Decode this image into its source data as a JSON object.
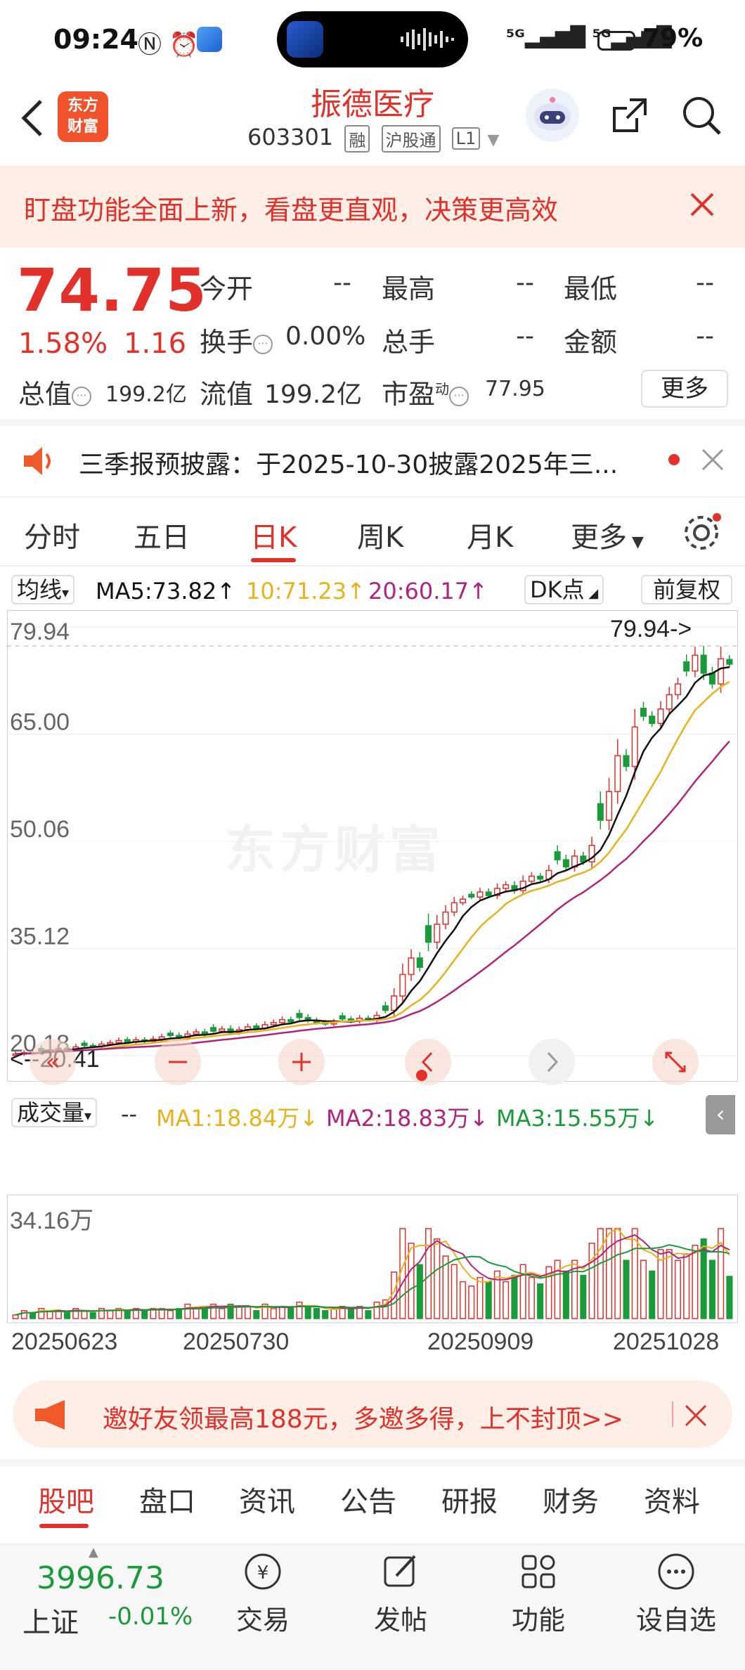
{
  "status": {
    "time": "09:24",
    "battery": "79%"
  },
  "header": {
    "logo_line1": "东方",
    "logo_line2": "财富",
    "stock_name": "振德医疗",
    "stock_code": "603301",
    "tag1": "融",
    "tag2": "沪股通",
    "tag3": "L1"
  },
  "banner": {
    "text": "盯盘功能全面上新，看盘更直观，决策更高效"
  },
  "quote": {
    "price": "74.75",
    "change_pct": "1.58%",
    "change": "1.16",
    "open_label": "今开",
    "open_value": "--",
    "high_label": "最高",
    "high_value": "--",
    "low_label": "最低",
    "low_value": "--",
    "turnover_label": "换手",
    "turnover_value": "0.00%",
    "volume_label": "总手",
    "volume_value": "--",
    "amount_label": "金额",
    "amount_value": "--",
    "mcap_label": "总值",
    "mcap_value": "199.2亿",
    "float_label": "流值",
    "float_value": "199.2亿",
    "pe_label": "市盈",
    "pe_sup": "动",
    "pe_value": "77.95",
    "more": "更多"
  },
  "notice": {
    "text": "三季报预披露：于2025-10-30披露2025年三..."
  },
  "tabs": [
    "分时",
    "五日",
    "日K",
    "周K",
    "月K",
    "更多"
  ],
  "ma": {
    "selector": "均线",
    "ma5": "MA5:73.82↑",
    "ma10": "10:71.23↑",
    "ma20": "20:60.17↑",
    "dk": "DK点",
    "adjust": "前复权",
    "colors": {
      "ma5": "#111111",
      "ma10": "#e7b21c",
      "ma20": "#b0237e"
    }
  },
  "chart_data": {
    "type": "candlestick",
    "y_ticks": [
      "79.94",
      "65.00",
      "50.06",
      "35.12",
      "20.18"
    ],
    "ylim": [
      20.18,
      79.94
    ],
    "high_marker": "79.94",
    "low_marker": "20.41",
    "x_ticks": [
      "20250623",
      "20250730",
      "20250909",
      "20251028"
    ],
    "closes": [
      20.4,
      20.6,
      20.5,
      20.8,
      21.0,
      21.2,
      21.1,
      21.4,
      21.6,
      21.5,
      21.8,
      22.0,
      22.3,
      22.1,
      22.4,
      22.2,
      22.5,
      22.8,
      23.0,
      22.7,
      23.2,
      23.5,
      23.1,
      23.6,
      23.9,
      23.4,
      23.8,
      24.2,
      24.0,
      24.5,
      24.8,
      25.2,
      24.9,
      25.5,
      25.1,
      24.8,
      24.6,
      24.9,
      25.3,
      25.0,
      25.4,
      25.2,
      25.8,
      26.5,
      28.5,
      31.5,
      33.8,
      32.5,
      36.0,
      38.5,
      40.2,
      41.5,
      42.0,
      42.3,
      43.0,
      42.5,
      43.5,
      44.0,
      43.2,
      44.5,
      45.2,
      44.8,
      46.0,
      47.5,
      46.5,
      48.0,
      47.2,
      49.5,
      53.0,
      57.0,
      62.0,
      60.5,
      66.0,
      67.5,
      66.5,
      68.5,
      70.5,
      72.0,
      73.8,
      76.0,
      73.5,
      72.0,
      75.5,
      74.75
    ],
    "volume_axis_max": "34.16万",
    "volume": {
      "selector": "成交量",
      "ma1": "MA1:18.84万↓",
      "ma2": "MA2:18.83万↓",
      "ma3": "MA3:15.55万↓",
      "colors": {
        "ma1": "#e7b21c",
        "ma2": "#b0237e",
        "ma3": "#1a9b3a"
      }
    }
  },
  "invite": {
    "text": "邀好友领最高188元，多邀多得，上不封顶>>"
  },
  "bottom_tabs": [
    "股吧",
    "盘口",
    "资讯",
    "公告",
    "研报",
    "财务",
    "资料"
  ],
  "nav": {
    "index_value": "3996.73",
    "index_name": "上证",
    "index_change": "-0.01%",
    "items": [
      "交易",
      "发帖",
      "功能",
      "设自选"
    ]
  }
}
